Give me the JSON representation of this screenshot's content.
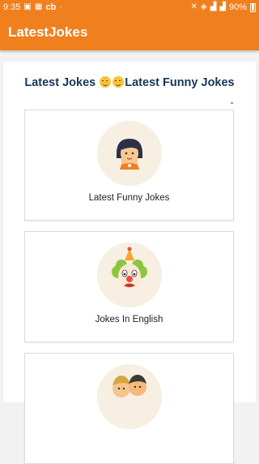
{
  "status_bar": {
    "time": "9:35",
    "carrier_badge": "cb",
    "battery_percent": "90%"
  },
  "app_bar": {
    "title": "LatestJokes"
  },
  "headline": {
    "part1": "Latest Jokes",
    "part2": "Latest Funny Jokes"
  },
  "categories": [
    {
      "label": "Latest Funny Jokes",
      "icon": "girl-avatar-icon"
    },
    {
      "label": "Jokes In English",
      "icon": "clown-icon"
    },
    {
      "label": "",
      "icon": "couple-icon"
    }
  ],
  "colors": {
    "accent": "#f07f1e",
    "headline": "#14375a",
    "icon_bg": "#f6efe2"
  }
}
